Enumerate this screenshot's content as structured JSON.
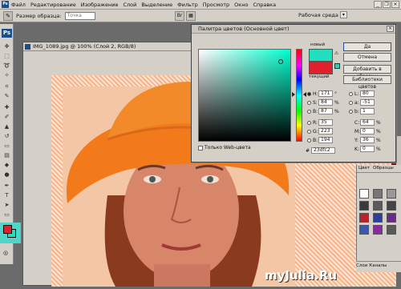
{
  "menubar": {
    "logo": "Ps",
    "items": [
      "Файл",
      "Редактирование",
      "Изображение",
      "Слой",
      "Выделение",
      "Фильтр",
      "Просмотр",
      "Окно",
      "Справка"
    ]
  },
  "options": {
    "sample_size_label": "Размер образца:",
    "sample_size_value": "Точка",
    "workspace_label": "Рабочая среда",
    "workspace_arrow": "▾"
  },
  "document": {
    "title": "IMG_1089.jpg @ 100% (Слой 2, RGB/8)"
  },
  "color_picker": {
    "title": "Палитра цветов (Основной цвет)",
    "new_label": "новый",
    "current_label": "текущий",
    "buttons": {
      "ok": "Да",
      "cancel": "Отмена",
      "add_swatches": "Добавить в образцы",
      "libraries": "Библиотеки цветов"
    },
    "web_only_label": "Только Web-цвета",
    "new_color": "#23dfc2",
    "current_color": "#e0202a",
    "fields": {
      "H": {
        "value": "171",
        "unit": "°"
      },
      "S": {
        "value": "84",
        "unit": "%"
      },
      "B": {
        "value": "87",
        "unit": "%"
      },
      "R": {
        "value": "35",
        "unit": ""
      },
      "G": {
        "value": "223",
        "unit": ""
      },
      "Bb": {
        "value": "194",
        "unit": ""
      },
      "L": {
        "value": "80",
        "unit": ""
      },
      "a": {
        "value": "-51",
        "unit": ""
      },
      "b": {
        "value": "1",
        "unit": ""
      },
      "C": {
        "value": "64",
        "unit": "%"
      },
      "M": {
        "value": "0",
        "unit": "%"
      },
      "Y": {
        "value": "36",
        "unit": "%"
      },
      "K": {
        "value": "0",
        "unit": "%"
      }
    },
    "hex_label": "#",
    "hex_value": "23dfc2"
  },
  "panels": {
    "tab_color": "Цвет",
    "tab_swatches": "Образцы",
    "tab_layers": "Слои",
    "tab_channels": "Каналы"
  },
  "watermark": "myJulia.Ru"
}
